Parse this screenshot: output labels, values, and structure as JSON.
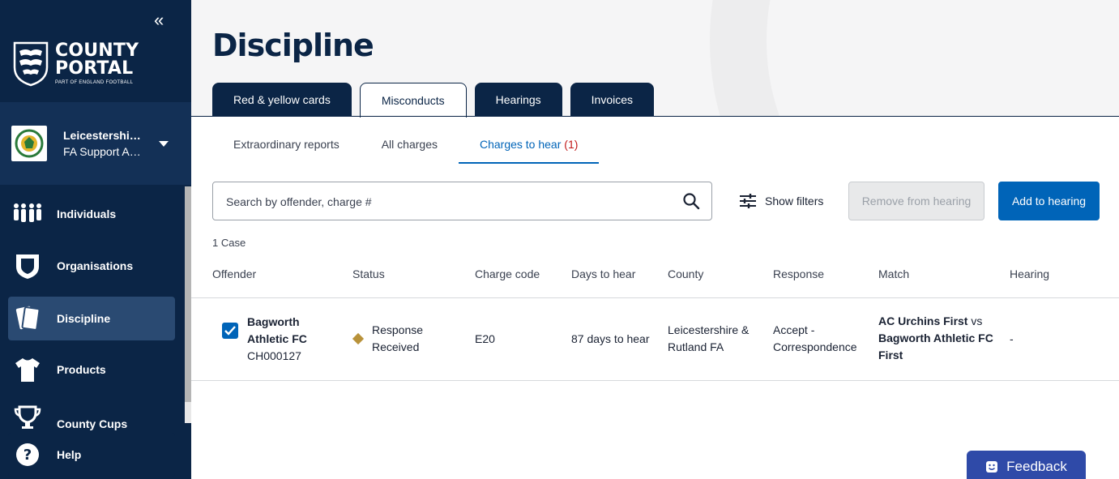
{
  "sidebar": {
    "collapse_icon": "double-chevron-left-icon",
    "brand_line1": "COUNTY",
    "brand_line2": "PORTAL",
    "brand_sub": "PART OF ENGLAND FOOTBALL",
    "org_name": "Leicestershire & Rutland FA",
    "org_role": "FA Support Admin",
    "items": [
      {
        "label": "Individuals",
        "icon": "people-icon",
        "active": false
      },
      {
        "label": "Organisations",
        "icon": "shield-icon",
        "active": false
      },
      {
        "label": "Discipline",
        "icon": "cards-icon",
        "active": true
      },
      {
        "label": "Products",
        "icon": "shirt-icon",
        "active": false
      },
      {
        "label": "County Cups",
        "icon": "trophy-icon",
        "active": false
      },
      {
        "label": "Help",
        "icon": "help-icon",
        "active": false
      }
    ]
  },
  "page": {
    "title": "Discipline",
    "tabs": [
      {
        "label": "Red & yellow cards",
        "active": false
      },
      {
        "label": "Misconducts",
        "active": true
      },
      {
        "label": "Hearings",
        "active": false
      },
      {
        "label": "Invoices",
        "active": false
      }
    ],
    "subtabs": [
      {
        "label": "Extraordinary reports",
        "active": false
      },
      {
        "label": "All charges",
        "active": false
      },
      {
        "label": "Charges to hear",
        "count": "(1)",
        "active": true
      }
    ]
  },
  "toolbar": {
    "search_placeholder": "Search by offender, charge #",
    "filters_label": "Show filters",
    "remove_label": "Remove from hearing",
    "add_label": "Add to hearing"
  },
  "table": {
    "case_count": "1 Case",
    "headers": [
      "Offender",
      "Status",
      "Charge code",
      "Days to hear",
      "County",
      "Response",
      "Match",
      "Hearing"
    ],
    "rows": [
      {
        "checked": true,
        "offender_line1": "Bagworth",
        "offender_line2": "Athletic FC",
        "charge_id": "CH000127",
        "status_line1": "Response",
        "status_line2": "Received",
        "status_color": "#b8923a",
        "charge_code": "E20",
        "days_to_hear": "87 days to hear",
        "county_line1": "Leicestershire &",
        "county_line2": "Rutland FA",
        "response_line1": "Accept -",
        "response_line2": "Correspondence",
        "match_home": "AC Urchins First",
        "match_vs": "vs",
        "match_away_line1": "Bagworth Athletic FC",
        "match_away_line2": "First",
        "hearing": "-"
      }
    ]
  },
  "feedback": {
    "label": "Feedback",
    "icon": "smile-icon"
  }
}
